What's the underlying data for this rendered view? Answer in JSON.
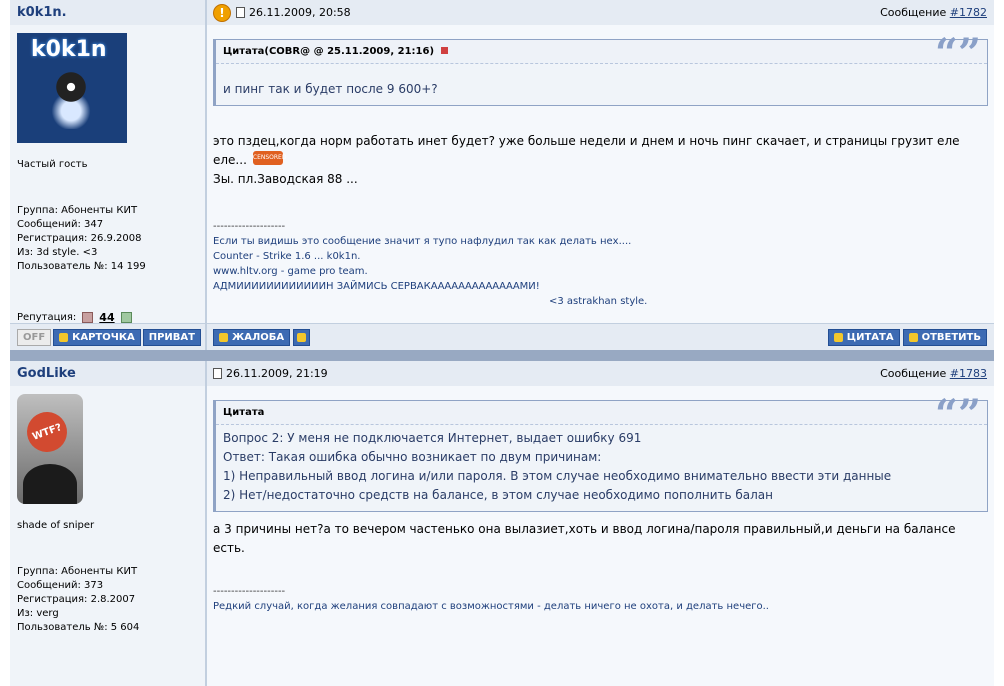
{
  "posts": [
    {
      "username": "k0k1n.",
      "date": "26.11.2009, 20:58",
      "msg_label": "Сообщение",
      "msg_num": "#1782",
      "avatar_text": "k0k1n",
      "rank": "Частый гость",
      "group": "Группа: Абоненты КИТ",
      "messages": "Сообщений: 347",
      "registered": "Регистрация: 26.9.2008",
      "from": "Из: 3d style. <3",
      "user_no": "Пользователь №: 14 199",
      "rep_label": "Репутация:",
      "rep_value": "44",
      "quote_title": "Цитата(COBR@ @ 25.11.2009, 21:16)",
      "quote_lines": [
        "и пинг так и будет после 9 600+?"
      ],
      "text_lines": [
        "это пздец,когда норм работать инет будет? уже больше недели и днем и ночь пинг скачает, и страницы грузит еле",
        "еле...",
        "Зы. пл.Заводская 88 ..."
      ],
      "censored": "CENSORED",
      "sig_sep": "--------------------",
      "sig_lines": [
        "Если ты видишь это сообщение значит я тупо нафлудил так как делать нех....",
        "Counter - Strike 1.6 ... k0k1n.",
        "www.hltv.org - game pro team.",
        "АДМИИИИИИИИИИИИН ЗАЙМИСЬ СЕРВАКАААААААААААААМИ!"
      ],
      "sig_right": "<3 astrakhan style."
    },
    {
      "username": "GodLike",
      "date": "26.11.2009, 21:19",
      "msg_label": "Сообщение",
      "msg_num": "#1783",
      "avatar_text": "WTF?",
      "rank": "shade of sniper",
      "group": "Группа: Абоненты КИТ",
      "messages": "Сообщений: 373",
      "registered": "Регистрация: 2.8.2007",
      "from": "Из: verg",
      "user_no": "Пользователь №: 5 604",
      "quote_title": "Цитата",
      "quote_lines": [
        "Вопрос 2: У меня не подключается Интернет, выдает ошибку 691",
        "Ответ: Такая ошибка обычно возникает по двум причинам:",
        "1) Неправильный ввод логина и/или пароля. В этом случае необходимо внимательно ввести эти данные",
        "2) Нет/недостаточно средств на балансе, в этом случае необходимо пополнить балан"
      ],
      "text_lines": [
        "а 3 причины нет?а то вечером частенько она вылазиет,хоть и ввод логина/пароля правильный,и деньги на балансе",
        "есть."
      ],
      "sig_sep": "--------------------",
      "sig_lines": [
        "Редкий случай, когда желания совпадают с возможностями - делать ничего не охота, и делать нечего.."
      ]
    }
  ],
  "buttons": {
    "off": "OFF",
    "card": "КАРТОЧКА",
    "private": "ПРИВАТ",
    "report": "ЖАЛОБА",
    "quote": "ЦИТАТА",
    "reply": "ОТВЕТИТЬ"
  },
  "colors": {
    "accent": "#3d6bb3",
    "username": "#1e3f7c",
    "header_bg": "#e5ebf3",
    "divider": "#98a9c2"
  }
}
